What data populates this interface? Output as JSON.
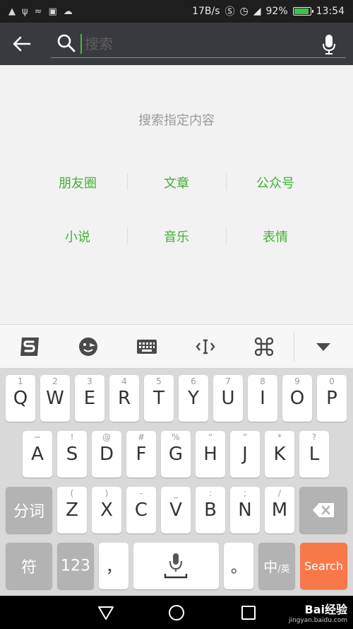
{
  "status_bar": {
    "network_speed": "17B/s",
    "battery_percent": "92%",
    "battery_level": 0.92,
    "time": "13:54",
    "icons": [
      "shield-icon",
      "usb-icon",
      "signal-icon",
      "image-icon",
      "cloud-icon",
      "nfc-icon",
      "alarm-icon",
      "cell-signal-icon"
    ]
  },
  "search_header": {
    "placeholder": "搜索",
    "value": ""
  },
  "main": {
    "hint": "搜索指定内容",
    "categories": [
      [
        "朋友圈",
        "文章",
        "公众号"
      ],
      [
        "小说",
        "音乐",
        "表情"
      ]
    ]
  },
  "keyboard": {
    "row1": [
      {
        "sub": "1",
        "key": "Q"
      },
      {
        "sub": "2",
        "key": "W"
      },
      {
        "sub": "3",
        "key": "E"
      },
      {
        "sub": "4",
        "key": "R"
      },
      {
        "sub": "5",
        "key": "T"
      },
      {
        "sub": "6",
        "key": "Y"
      },
      {
        "sub": "7",
        "key": "U"
      },
      {
        "sub": "8",
        "key": "I"
      },
      {
        "sub": "9",
        "key": "O"
      },
      {
        "sub": "0",
        "key": "P"
      }
    ],
    "row2": [
      {
        "sub": "~",
        "key": "A"
      },
      {
        "sub": "!",
        "key": "S"
      },
      {
        "sub": "@",
        "key": "D"
      },
      {
        "sub": "#",
        "key": "F"
      },
      {
        "sub": "%",
        "key": "G"
      },
      {
        "sub": "“",
        "key": "H"
      },
      {
        "sub": "”",
        "key": "J"
      },
      {
        "sub": "*",
        "key": "K"
      },
      {
        "sub": "?",
        "key": "L"
      }
    ],
    "row3": [
      {
        "sub": "(",
        "key": "Z"
      },
      {
        "sub": ")",
        "key": "X"
      },
      {
        "sub": "-",
        "key": "C"
      },
      {
        "sub": "_",
        "key": "V"
      },
      {
        "sub": ":",
        "key": "B"
      },
      {
        "sub": ";",
        "key": "N"
      },
      {
        "sub": "/",
        "key": "M"
      }
    ],
    "segment_label": "分词",
    "symbol_label": "符",
    "numbers_label": "123",
    "comma_label": "，",
    "period_label": "。",
    "lang_label_main": "中",
    "lang_label_sub": "/英",
    "search_label": "Search"
  },
  "watermark": {
    "brand": "Bai",
    "brand_suffix": "经验",
    "url": "jingyan.baidu.com"
  }
}
